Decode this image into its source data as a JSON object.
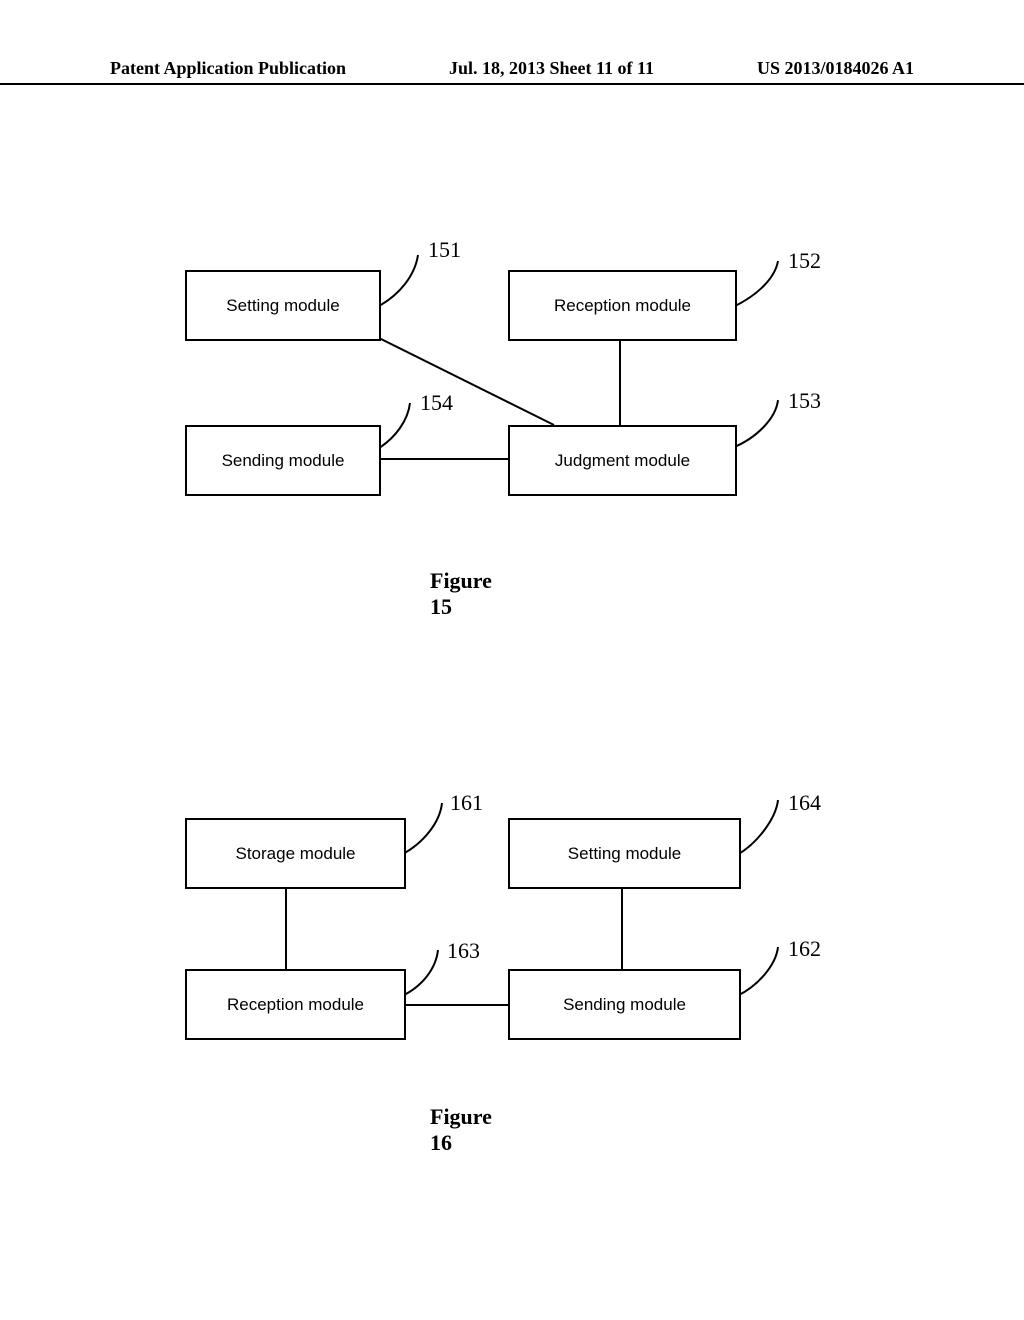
{
  "header": {
    "left": "Patent Application Publication",
    "mid": "Jul. 18, 2013   Sheet 11 of 11",
    "right": "US 2013/0184026 A1"
  },
  "fig15": {
    "caption": "Figure 15",
    "boxes": {
      "setting": "Setting module",
      "reception": "Reception module",
      "sending": "Sending module",
      "judgment": "Judgment module"
    },
    "refs": {
      "setting": "151",
      "reception": "152",
      "judgment": "153",
      "sending": "154"
    }
  },
  "fig16": {
    "caption": "Figure 16",
    "boxes": {
      "storage": "Storage module",
      "setting": "Setting module",
      "reception": "Reception module",
      "sending": "Sending module"
    },
    "refs": {
      "storage": "161",
      "setting": "164",
      "reception": "163",
      "sending": "162"
    }
  }
}
